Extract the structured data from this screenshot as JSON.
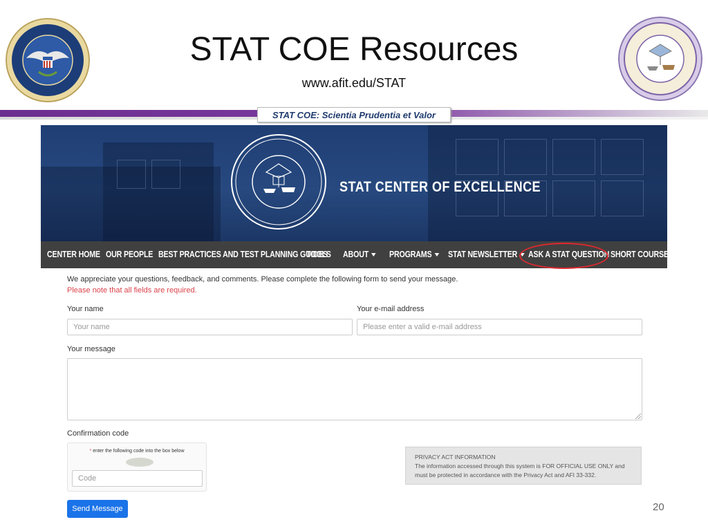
{
  "slide": {
    "title": "STAT COE Resources",
    "url": "www.afit.edu/STAT",
    "motto": "STAT COE:  Scientia Prudentia et Valor",
    "page_number": "20"
  },
  "banner": {
    "title": "STAT CENTER OF EXCELLENCE"
  },
  "nav": {
    "items": [
      {
        "label": "CENTER HOME",
        "dropdown": false
      },
      {
        "label": "OUR PEOPLE",
        "dropdown": false
      },
      {
        "label": "BEST PRACTICES AND TEST PLANNING GUIDES",
        "dropdown": false
      },
      {
        "label": "TOOLS",
        "dropdown": false
      },
      {
        "label": "ABOUT",
        "dropdown": true
      },
      {
        "label": "PROGRAMS",
        "dropdown": true
      },
      {
        "label": "STAT NEWSLETTER",
        "dropdown": true
      },
      {
        "label": "ASK A STAT QUESTION",
        "dropdown": false,
        "highlighted": true
      },
      {
        "label": "SHORT COURSES",
        "dropdown": false
      }
    ]
  },
  "form": {
    "intro": "We appreciate your questions, feedback, and comments. Please complete the following form to send your message.",
    "required_note": "Please note that all fields are required.",
    "name_label": "Your name",
    "name_placeholder": "Your name",
    "email_label": "Your e-mail address",
    "email_placeholder": "Please enter a valid e-mail address",
    "message_label": "Your message",
    "message_placeholder": "",
    "confirmation_label": "Confirmation code",
    "captcha_hint": "enter the following code into the box below",
    "captcha_required_mark": "*",
    "code_placeholder": "Code",
    "send_label": "Send Message"
  },
  "privacy": {
    "heading": "PRIVACY ACT INFORMATION",
    "line1": "The information accessed through this system is FOR OFFICIAL USE ONLY and",
    "line2": "must be protected in accordance with the Privacy Act and AFI 33-332."
  },
  "colors": {
    "nav_bg": "#404040",
    "banner_bg": "#1f3e74",
    "highlight_circle": "#e0282f",
    "required_text": "#d9434b",
    "button_bg": "#1a73e8",
    "accent_bar": "#6b2f8f"
  }
}
